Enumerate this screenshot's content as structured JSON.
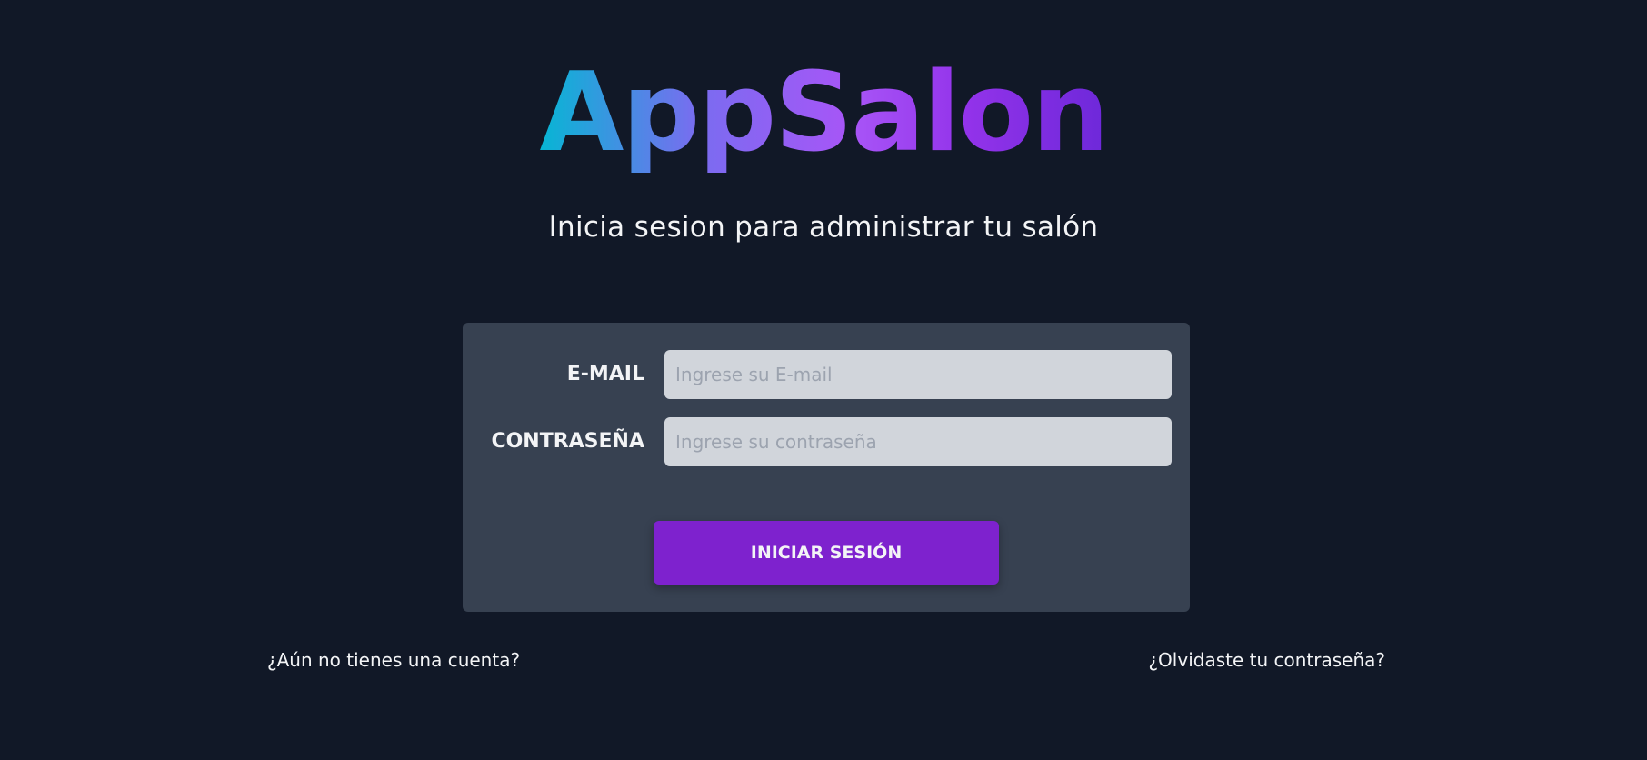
{
  "logo": {
    "text": "AppSalon"
  },
  "subtitle": "Inicia sesion para administrar tu salón",
  "form": {
    "email": {
      "label": "E-MAIL",
      "placeholder": "Ingrese su E-mail",
      "value": ""
    },
    "password": {
      "label": "CONTRASEÑA",
      "placeholder": "Ingrese su contraseña",
      "value": ""
    },
    "submit_label": "INICIAR SESIÓN"
  },
  "links": {
    "register": "¿Aún no tienes una cuenta?",
    "forgot_password": "¿Olvidaste tu contraseña?"
  },
  "colors": {
    "background": "#111827",
    "card": "#374151",
    "input": "#d1d5db",
    "button": "#7e22ce",
    "logo_gradient_start": "#06b6d4",
    "logo_gradient_end": "#6d28d9"
  }
}
